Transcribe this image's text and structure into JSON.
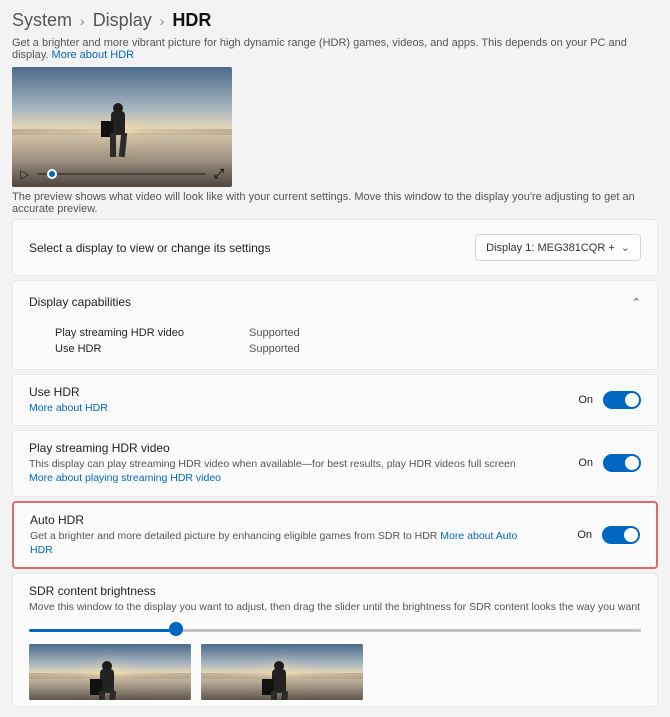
{
  "breadcrumb": {
    "a": "System",
    "b": "Display",
    "c": "HDR"
  },
  "intro": {
    "text": "Get a brighter and more vibrant picture for high dynamic range (HDR) games, videos, and apps. This depends on your PC and display.",
    "link": "More about HDR"
  },
  "preview_note": "The preview shows what video will look like with your current settings. Move this window to the display you're adjusting to get an accurate preview.",
  "select_display": {
    "label": "Select a display to view or change its settings",
    "value": "Display 1: MEG381CQR +"
  },
  "capabilities": {
    "title": "Display capabilities",
    "rows": [
      {
        "k": "Play streaming HDR video",
        "v": "Supported"
      },
      {
        "k": "Use HDR",
        "v": "Supported"
      }
    ]
  },
  "use_hdr": {
    "title": "Use HDR",
    "link": "More about HDR",
    "state": "On"
  },
  "stream_hdr": {
    "title": "Play streaming HDR video",
    "sub_pre": "This display can play streaming HDR video when available—for best results, play HDR videos full screen ",
    "link": "More about playing streaming HDR video",
    "state": "On"
  },
  "auto_hdr": {
    "title": "Auto HDR",
    "sub_pre": "Get a brighter and more detailed picture by enhancing eligible games from SDR to HDR ",
    "link": "More about Auto HDR",
    "state": "On"
  },
  "sdr": {
    "title": "SDR content brightness",
    "sub": "Move this window to the display you want to adjust, then drag the slider until the brightness for SDR content looks the way you want"
  }
}
